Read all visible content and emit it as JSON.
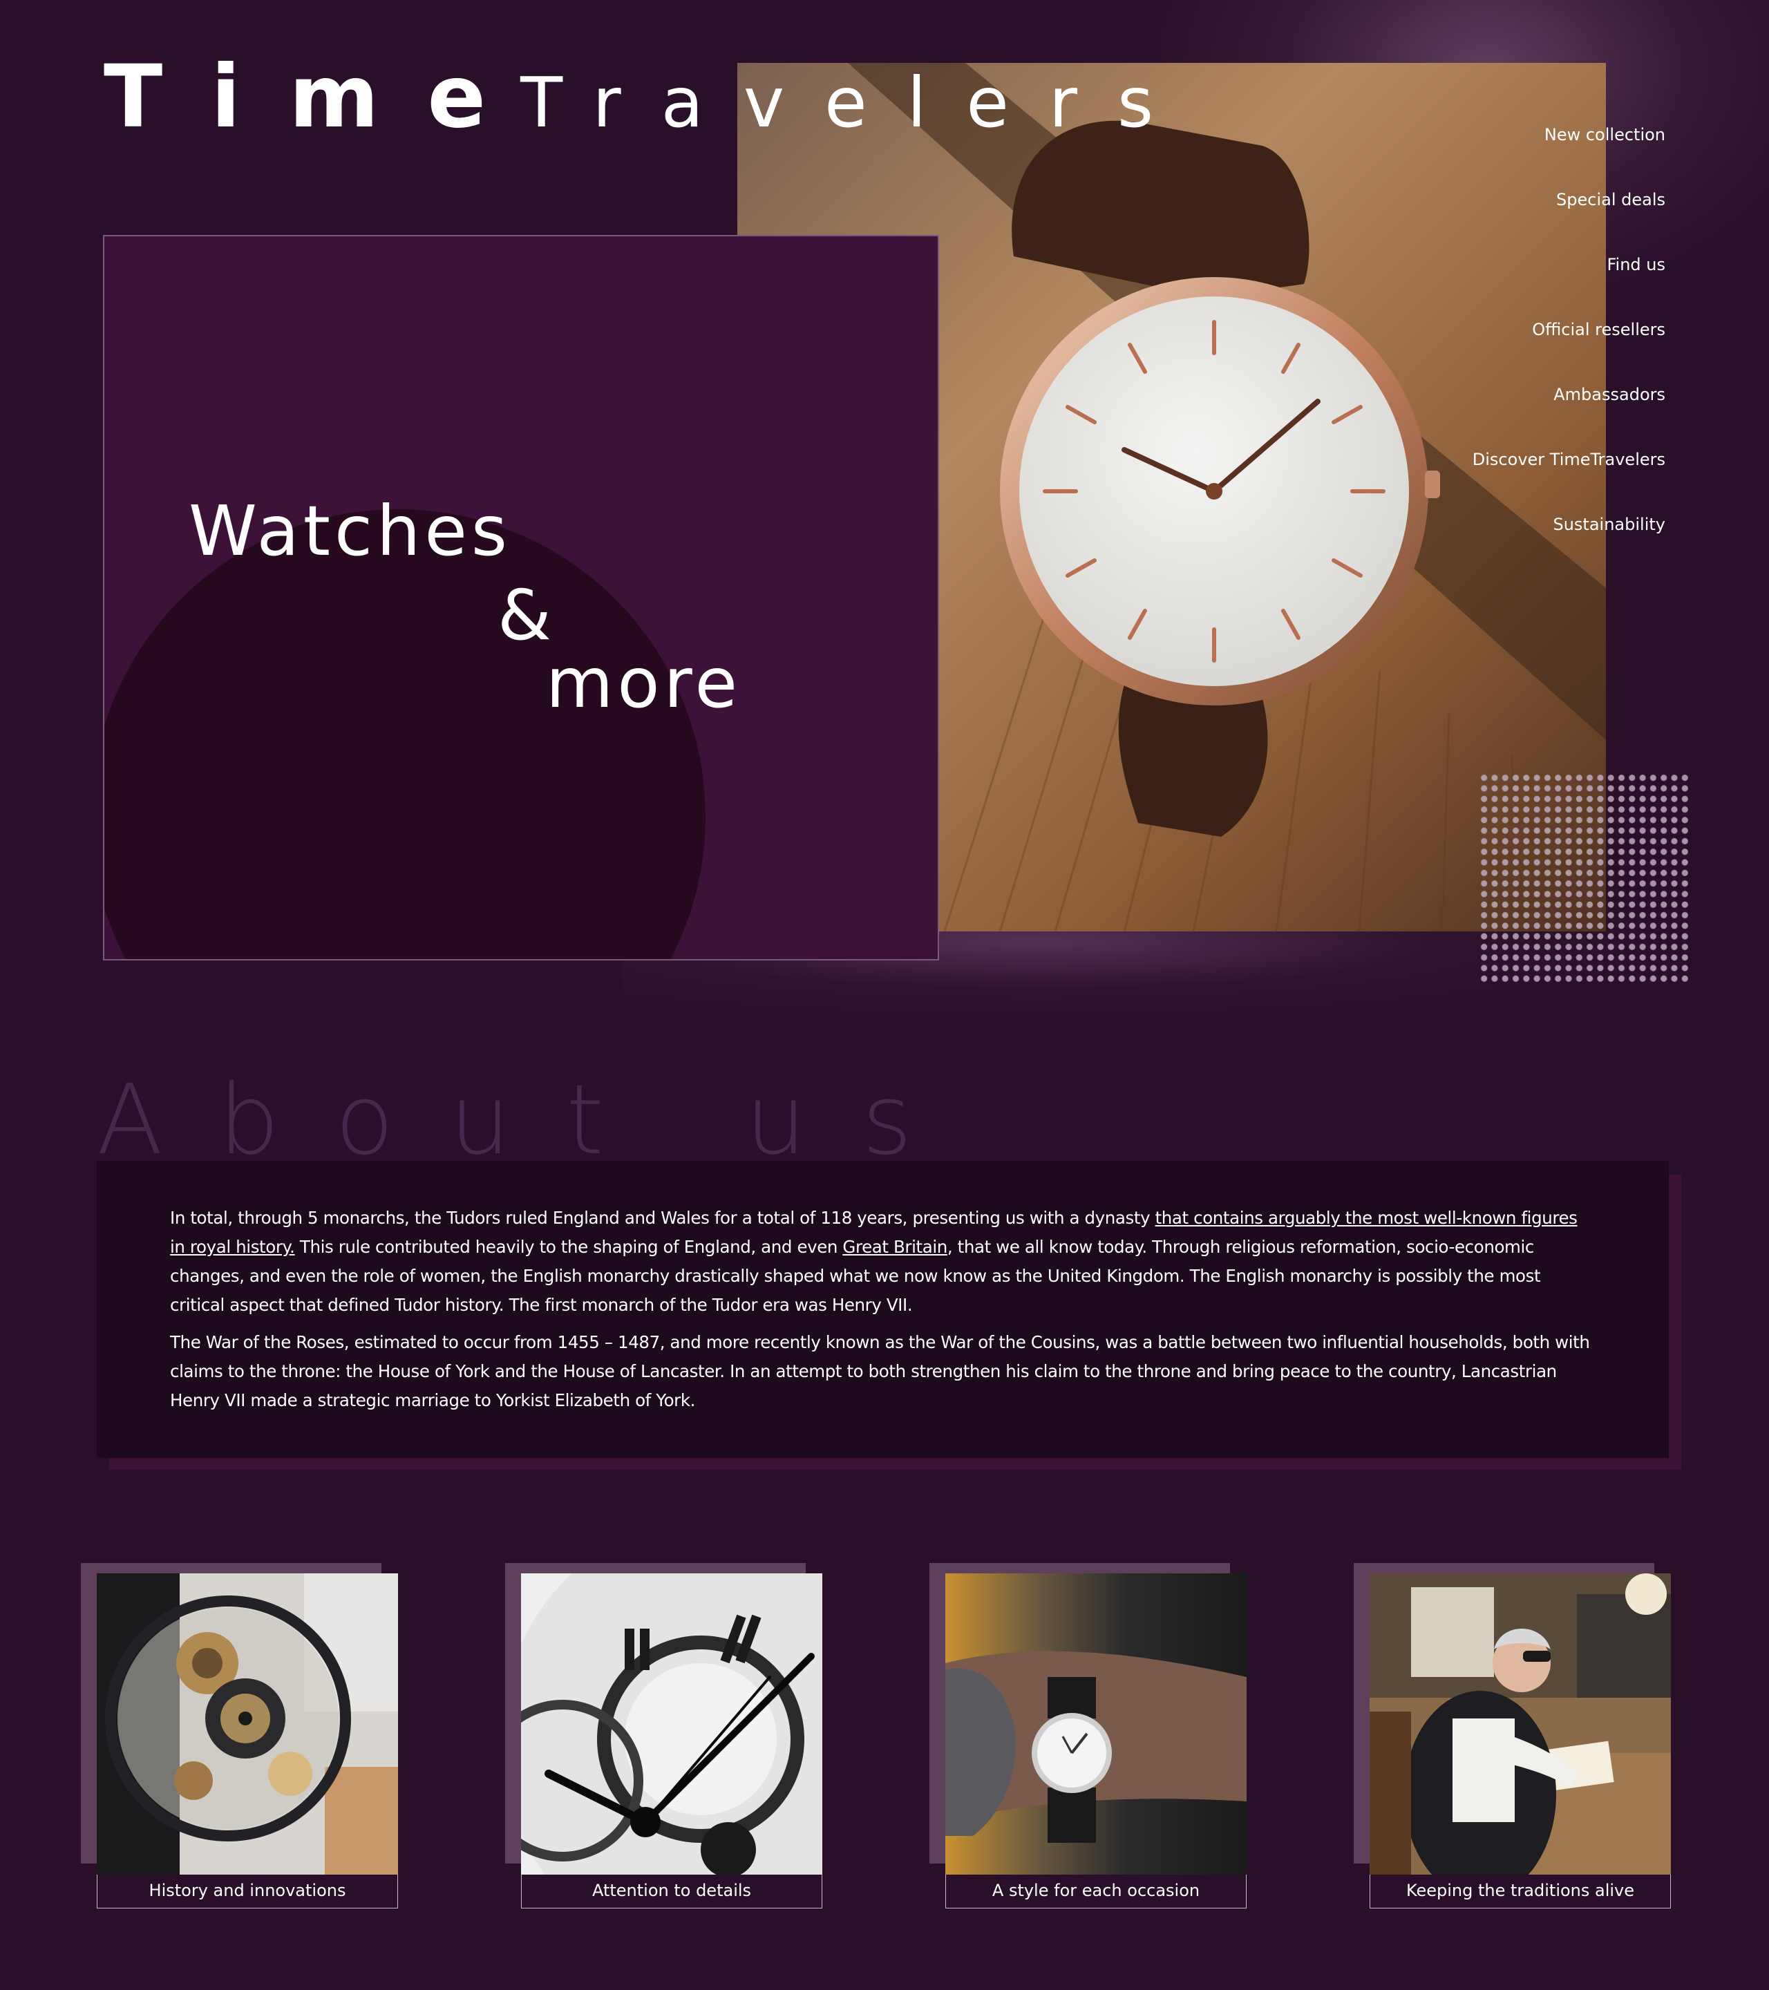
{
  "brand": {
    "logo_time": "Time",
    "logo_travelers": "Travelers"
  },
  "hero": {
    "line1": "Watches",
    "line2": "&",
    "line3": "more",
    "photo_subject": "wristwatch-photo"
  },
  "nav": {
    "items": [
      {
        "label": "New collection"
      },
      {
        "label": "Special deals"
      },
      {
        "label": "Find us"
      },
      {
        "label": "Official resellers"
      },
      {
        "label": "Ambassadors"
      },
      {
        "label": "Discover TimeTravelers"
      },
      {
        "label": "Sustainability"
      }
    ]
  },
  "about": {
    "title": "About us",
    "p1_a": "In total, through 5 monarchs, the Tudors ruled England and Wales for a total of 118 years, presenting us with a dynasty ",
    "p1_link1": "that contains arguably the most well-known figures in royal history.",
    "p1_b": " This rule contributed heavily to the shaping of England, and even ",
    "p1_link2": "Great Britain",
    "p1_c": ", that we all know today. Through religious reformation, socio-economic changes, and even the role of women, the English monarchy drastically shaped what we now know as the United Kingdom. The English monarchy is possibly the most critical aspect that defined Tudor history. The first monarch of the Tudor era was Henry VII.",
    "p2": "The War of the Roses, estimated to occur from 1455 – 1487, and more recently known as the War of the Cousins, was a battle between two influential households, both with claims to the throne: the House of York and the House of Lancaster. In an attempt to both strengthen his claim to the throne and bring peace to the country, Lancastrian Henry VII made a strategic marriage to Yorkist Elizabeth of York."
  },
  "cards": [
    {
      "label": "History and innovations"
    },
    {
      "label": "Attention to details"
    },
    {
      "label": "A style for each occasion"
    },
    {
      "label": "Keeping the traditions alive"
    }
  ],
  "colors": {
    "background": "#2a0f2a",
    "card_purple": "#3d1239",
    "about_box": "#1e0a1d",
    "accent_shadow": "#5e405c"
  }
}
